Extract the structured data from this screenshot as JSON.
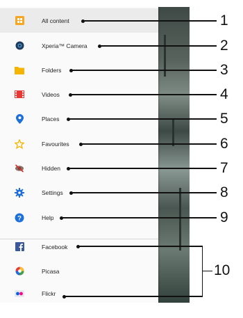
{
  "menu": {
    "items": [
      {
        "label": "All content",
        "icon": "all-content-icon",
        "color": "#f5a623",
        "selected": true
      },
      {
        "label": "Xperia™ Camera",
        "icon": "camera-icon",
        "color": "#1f3a5f"
      },
      {
        "label": "Folders",
        "icon": "folder-icon",
        "color": "#f5b400"
      },
      {
        "label": "Videos",
        "icon": "film-icon",
        "color": "#e53935"
      },
      {
        "label": "Places",
        "icon": "location-pin-icon",
        "color": "#1e6fd9"
      },
      {
        "label": "Favourites",
        "icon": "star-icon",
        "color": "#f5b400"
      },
      {
        "label": "Hidden",
        "icon": "hidden-eye-icon",
        "color": "#d32f2f"
      },
      {
        "label": "Settings",
        "icon": "gear-icon",
        "color": "#1e6fd9"
      },
      {
        "label": "Help",
        "icon": "help-icon",
        "color": "#1e6fd9"
      },
      {
        "label": "Facebook",
        "icon": "facebook-icon",
        "color": "#3b5998"
      },
      {
        "label": "Picasa",
        "icon": "picasa-icon",
        "color": "#e53935"
      },
      {
        "label": "Flickr",
        "icon": "flickr-icon",
        "color": "#0063dc"
      }
    ]
  },
  "callouts": [
    "1",
    "2",
    "3",
    "4",
    "5",
    "6",
    "7",
    "8",
    "9",
    "10"
  ],
  "navbar": {
    "back": "back-icon",
    "home": "home-icon",
    "recent": "recent-apps-icon"
  }
}
